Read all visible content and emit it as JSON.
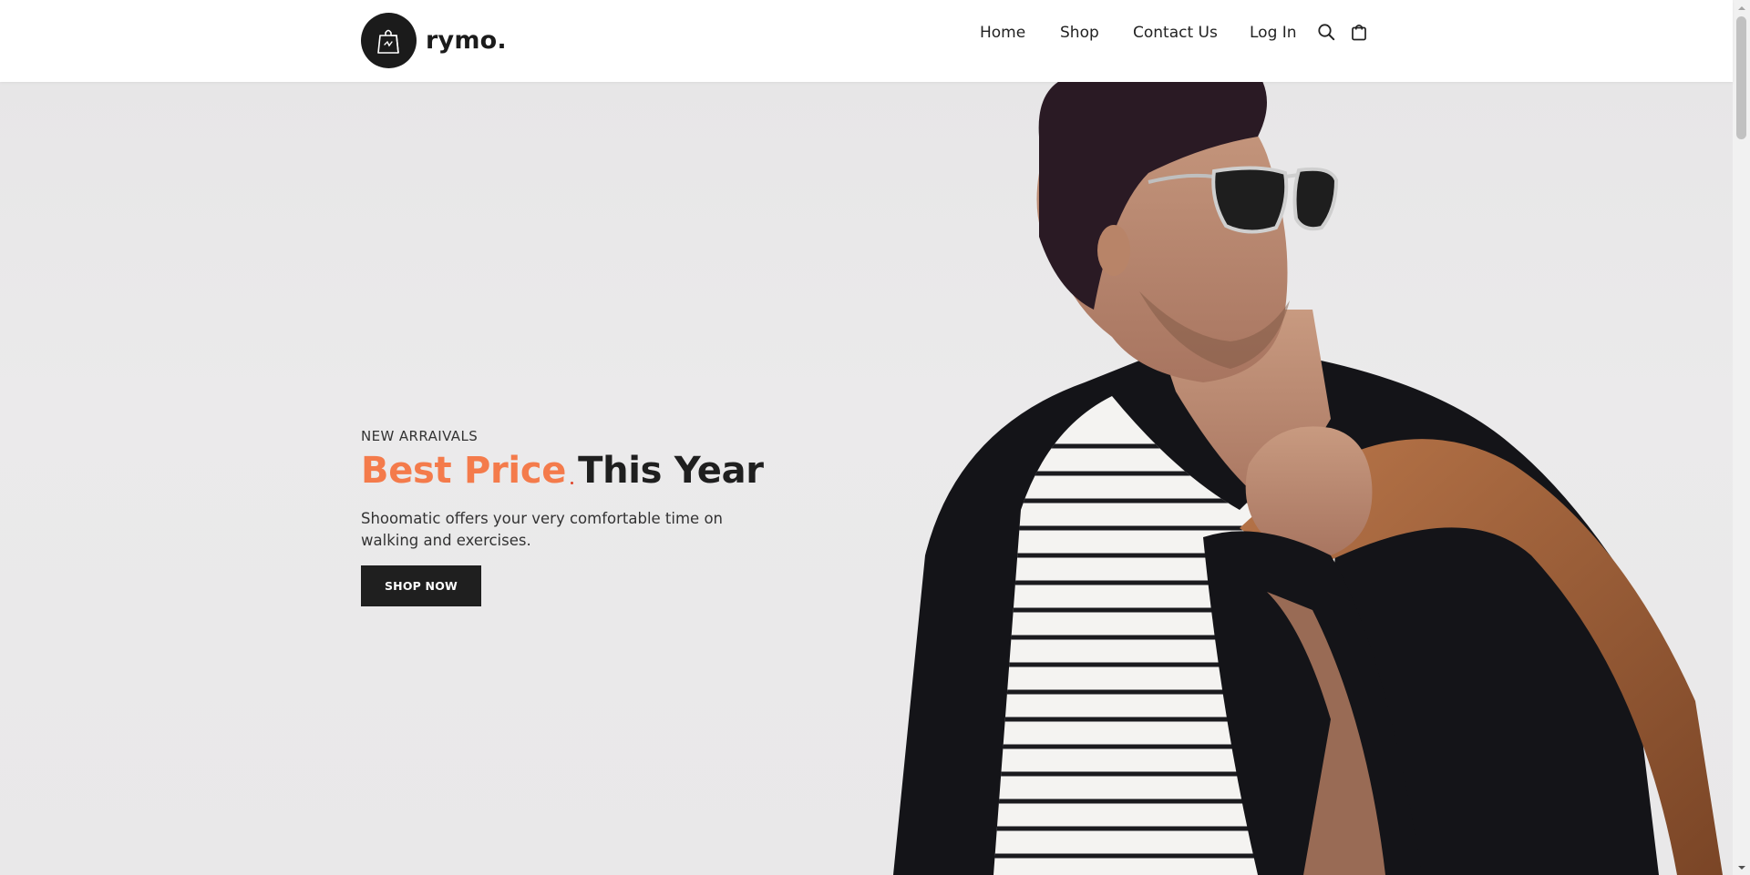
{
  "header": {
    "logo_text": "rymo.",
    "nav": [
      {
        "label": "Home"
      },
      {
        "label": "Shop"
      },
      {
        "label": "Contact Us"
      },
      {
        "label": "Log In"
      }
    ],
    "icons": [
      "search-icon",
      "shopping-bag-icon"
    ]
  },
  "hero": {
    "eyebrow": "NEW ARRAIVALS",
    "headline_accent": "Best Price",
    "headline_rest": "This Year",
    "description": "Shoomatic offers your very comfortable time on walking and exercises.",
    "cta_label": "SHOP NOW"
  },
  "colors": {
    "accent": "#f47b4b",
    "dark": "#1f1f1f",
    "hero_background": "#e9e8e9"
  }
}
